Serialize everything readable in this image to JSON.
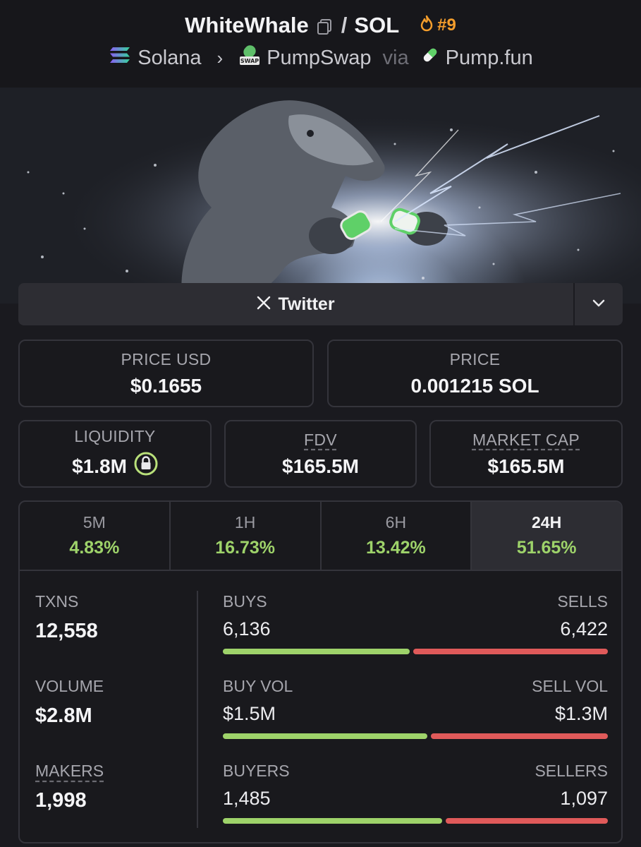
{
  "header": {
    "token": "WhiteWhale",
    "slash": "/",
    "quote": "SOL",
    "rank": "#9",
    "chain": "Solana",
    "dex": "PumpSwap",
    "via": "via",
    "launchpad": "Pump.fun"
  },
  "social": {
    "twitter_label": "Twitter"
  },
  "prices": {
    "price_usd_label": "PRICE USD",
    "price_usd": "$0.1655",
    "price_label": "PRICE",
    "price_native": "0.001215 SOL"
  },
  "metrics": {
    "liquidity_label": "LIQUIDITY",
    "liquidity": "$1.8M",
    "fdv_label": "FDV",
    "fdv": "$165.5M",
    "mcap_label": "MARKET CAP",
    "mcap": "$165.5M"
  },
  "timeframes": [
    {
      "label": "5M",
      "change": "4.83%"
    },
    {
      "label": "1H",
      "change": "16.73%"
    },
    {
      "label": "6H",
      "change": "13.42%"
    },
    {
      "label": "24H",
      "change": "51.65%"
    }
  ],
  "active_timeframe": "24H",
  "stats": {
    "txns_label": "TXNS",
    "txns": "12,558",
    "volume_label": "VOLUME",
    "volume": "$2.8M",
    "makers_label": "MAKERS",
    "makers": "1,998"
  },
  "pairs": {
    "buys_label": "BUYS",
    "sells_label": "SELLS",
    "buys": "6,136",
    "sells": "6,422",
    "buy_vol_label": "BUY VOL",
    "sell_vol_label": "SELL VOL",
    "buy_vol": "$1.5M",
    "sell_vol": "$1.3M",
    "buyers_label": "BUYERS",
    "sellers_label": "SELLERS",
    "buyers": "1,485",
    "sellers": "1,097",
    "buys_fraction": 0.49,
    "buy_vol_fraction": 0.536,
    "buyers_fraction": 0.575
  },
  "colors": {
    "positive": "#9ed36a",
    "negative": "#e05a5a",
    "rank": "#f59e2c",
    "background": "#1a1a1f"
  }
}
